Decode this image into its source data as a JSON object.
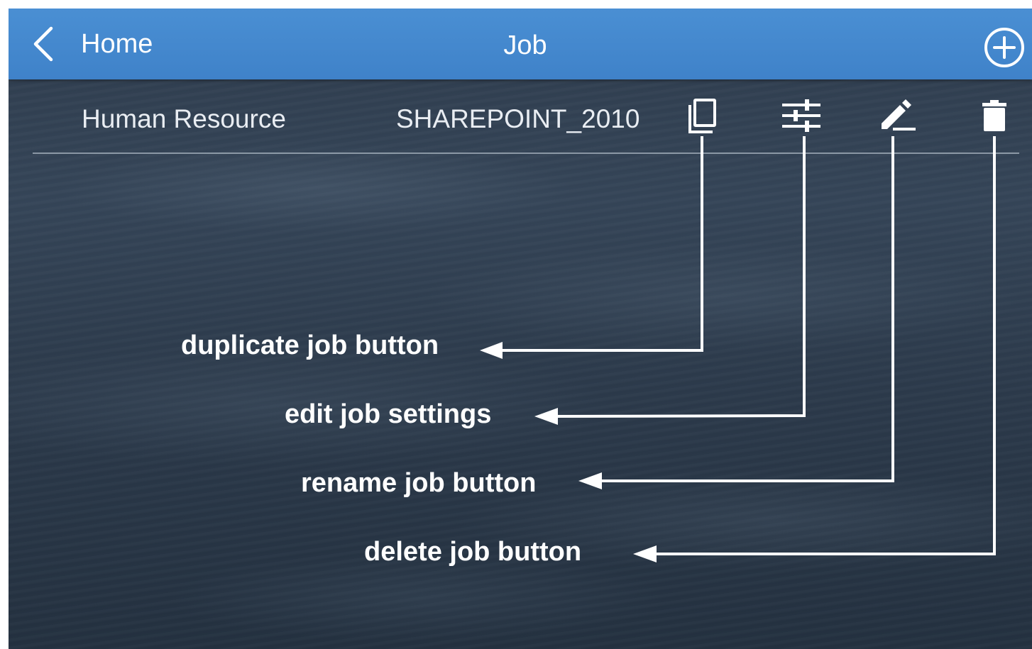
{
  "app_bar": {
    "back_label": "Home",
    "title": "Job",
    "icons": {
      "back": "chevron-left-icon",
      "add": "add-circle-icon"
    },
    "color": "#4289cf"
  },
  "job_row": {
    "name": "Human Resource",
    "source": "SHAREPOINT_2010",
    "actions": [
      {
        "icon": "copy-icon",
        "purpose": "duplicate"
      },
      {
        "icon": "sliders-icon",
        "purpose": "settings"
      },
      {
        "icon": "pencil-icon",
        "purpose": "rename"
      },
      {
        "icon": "trash-icon",
        "purpose": "delete"
      }
    ]
  },
  "annotations": [
    {
      "label": "duplicate job button",
      "target": "duplicate"
    },
    {
      "label": "edit job settings",
      "target": "settings"
    },
    {
      "label": "rename job button",
      "target": "rename"
    },
    {
      "label": "delete job button",
      "target": "delete"
    }
  ],
  "colors": {
    "background": "#2f3d4e",
    "text": "#ffffff",
    "annotation": "#ffffff"
  }
}
